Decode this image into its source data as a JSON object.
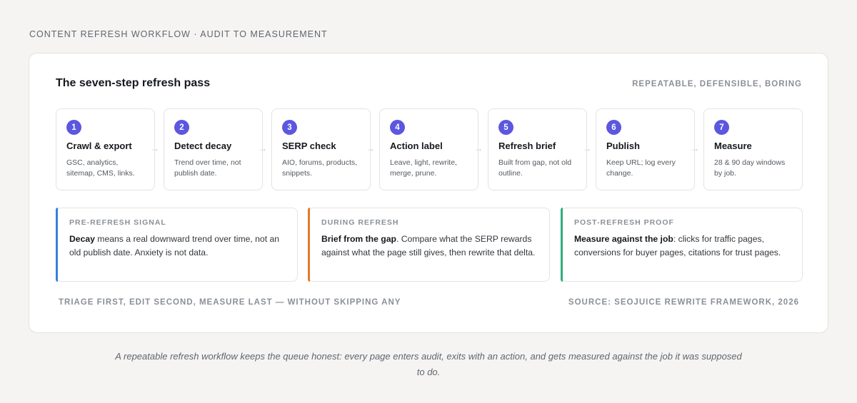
{
  "eyebrow": "CONTENT REFRESH WORKFLOW · AUDIT TO MEASUREMENT",
  "card": {
    "title": "The seven-step refresh pass",
    "tag": "REPEATABLE, DEFENSIBLE, BORING"
  },
  "steps": [
    {
      "num": "1",
      "title": "Crawl & export",
      "desc": "GSC, analytics, sitemap, CMS, links."
    },
    {
      "num": "2",
      "title": "Detect decay",
      "desc": "Trend over time, not publish date."
    },
    {
      "num": "3",
      "title": "SERP check",
      "desc": "AIO, forums, products, snippets."
    },
    {
      "num": "4",
      "title": "Action label",
      "desc": "Leave, light, rewrite, merge, prune."
    },
    {
      "num": "5",
      "title": "Refresh brief",
      "desc": "Built from gap, not old outline."
    },
    {
      "num": "6",
      "title": "Publish",
      "desc": "Keep URL; log every change."
    },
    {
      "num": "7",
      "title": "Measure",
      "desc": "28 & 90 day windows by job."
    }
  ],
  "arrow_glyph": "→",
  "phases": [
    {
      "label": "PRE-REFRESH SIGNAL",
      "lead": "Decay",
      "body": " means a real downward trend over time, not an old publish date. Anxiety is not data.",
      "accent": "#3a7fd5"
    },
    {
      "label": "DURING REFRESH",
      "lead": "Brief from the gap",
      "body": ". Compare what the SERP rewards against what the page still gives, then rewrite that delta.",
      "accent": "#e07a2c"
    },
    {
      "label": "POST-REFRESH PROOF",
      "lead": "Measure against the job",
      "body": ": clicks for traffic pages, conversions for buyer pages, citations for trust pages.",
      "accent": "#2fae7b"
    }
  ],
  "footer": {
    "left": "TRIAGE FIRST, EDIT SECOND, MEASURE LAST — WITHOUT SKIPPING ANY",
    "right": "SOURCE: SEOJUICE REWRITE FRAMEWORK, 2026"
  },
  "caption": "A repeatable refresh workflow keeps the queue honest: every page enters audit, exits with an action, and gets measured against the job it was supposed to do.",
  "colors": {
    "badge": "#5b57e0",
    "background": "#f5f4f2"
  }
}
